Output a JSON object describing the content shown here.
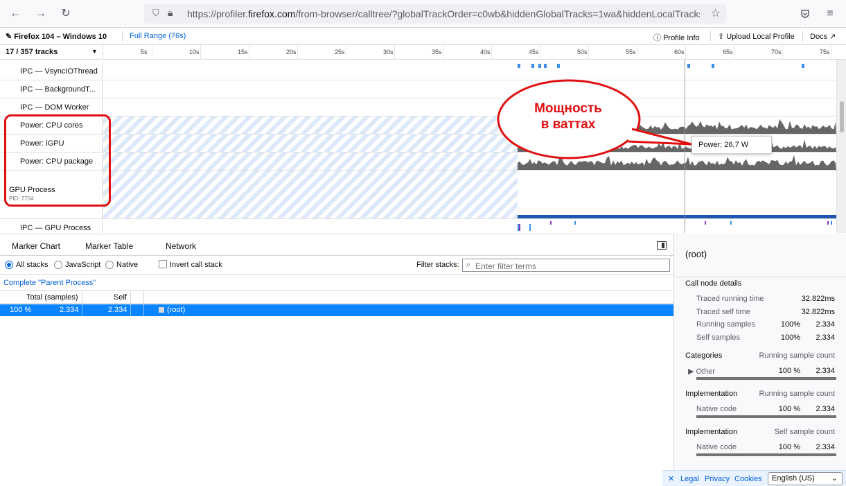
{
  "browser": {
    "url_prefix": "https://profiler.",
    "url_domain": "firefox.com",
    "url_rest": "/from-browser/calltree/?globalTrackOrder=c0wb&hiddenGlobalTracks=1wa&hiddenLocalTracksB"
  },
  "topbar": {
    "title": "Firefox 104 – Windows 10",
    "range": "Full Range (76s)",
    "profile_info": "Profile Info",
    "upload": "Upload Local Profile",
    "docs": "Docs"
  },
  "tracks_header": {
    "count": "17 / 357 tracks",
    "ticks": [
      "5s",
      "10s",
      "15s",
      "20s",
      "25s",
      "30s",
      "35s",
      "40s",
      "45s",
      "50s",
      "55s",
      "60s",
      "65s",
      "70s",
      "75s"
    ]
  },
  "tracks": [
    {
      "label": "IPC — VsyncIOThread"
    },
    {
      "label": "IPC — BackgroundT..."
    },
    {
      "label": "IPC — DOM Worker"
    },
    {
      "label": "Power: CPU cores"
    },
    {
      "label": "Power: iGPU"
    },
    {
      "label": "Power: CPU package"
    }
  ],
  "gpu_process": {
    "name": "GPU Process",
    "pid": "PID: 7704"
  },
  "ipc_gpu": {
    "label": "IPC — GPU Process"
  },
  "annotation": {
    "line1": "Мощность",
    "line2": "в ваттах"
  },
  "tooltip": {
    "text": "Power: 26,7 W"
  },
  "tabs": [
    "Marker Chart",
    "Marker Table",
    "Network"
  ],
  "settings": {
    "all_stacks": "All stacks",
    "javascript": "JavaScript",
    "native": "Native",
    "invert": "Invert call stack",
    "filter_label": "Filter stacks:",
    "filter_placeholder": "Enter filter terms"
  },
  "breadcrumb": "Complete \"Parent Process\"",
  "tree": {
    "col_total": "Total (samples)",
    "col_self": "Self",
    "row": {
      "percent": "100 %",
      "total": "2.334",
      "self": "2.334",
      "name": "(root)"
    }
  },
  "sidebar": {
    "title": "(root)",
    "details_heading": "Call node details",
    "traced_running_label": "Traced running time",
    "traced_running_value": "32.822ms",
    "traced_self_label": "Traced self time",
    "traced_self_value": "32.822ms",
    "running_samples_label": "Running samples",
    "running_samples_pct": "100%",
    "running_samples_value": "2.334",
    "self_samples_label": "Self samples",
    "self_samples_pct": "100%",
    "self_samples_value": "2.334",
    "categories_heading": "Categories",
    "categories_right": "Running sample count",
    "category_name": "Other",
    "category_pct": "100 %",
    "category_value": "2.334",
    "impl1_heading": "Implementation",
    "impl1_right": "Running sample count",
    "impl1_name": "Native code",
    "impl1_pct": "100 %",
    "impl1_value": "2.334",
    "impl2_heading": "Implementation",
    "impl2_right": "Self sample count",
    "impl2_name": "Native code",
    "impl2_pct": "100 %",
    "impl2_value": "2.334"
  },
  "footer": {
    "legal": "Legal",
    "privacy": "Privacy",
    "cookies": "Cookies",
    "language": "English (US)"
  },
  "colors": {
    "accent": "#0060df",
    "selection": "#0a84ff",
    "annotation_red": "#e01010",
    "graph_gray": "#666666",
    "ipc_blue": "#3a8ee6"
  }
}
